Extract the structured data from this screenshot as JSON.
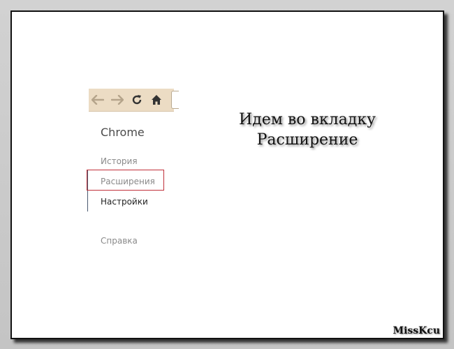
{
  "toolbar": {
    "back_icon": "arrow-left-icon",
    "forward_icon": "arrow-right-icon",
    "reload_icon": "reload-icon",
    "home_icon": "home-icon",
    "icon_color_disabled": "#b5a48b",
    "icon_color_enabled": "#333333",
    "background": "#ecdcc4"
  },
  "sidebar": {
    "brand": "Chrome",
    "items": [
      {
        "label": "История",
        "state": "normal"
      },
      {
        "label": "Расширения",
        "state": "highlighted"
      },
      {
        "label": "Настройки",
        "state": "active"
      },
      {
        "label": "Справка",
        "state": "normal"
      }
    ],
    "highlight_color": "#c0303a"
  },
  "caption": {
    "line1": "Идем во вкладку",
    "line2": "Расширение"
  },
  "watermark": "MissKcu"
}
